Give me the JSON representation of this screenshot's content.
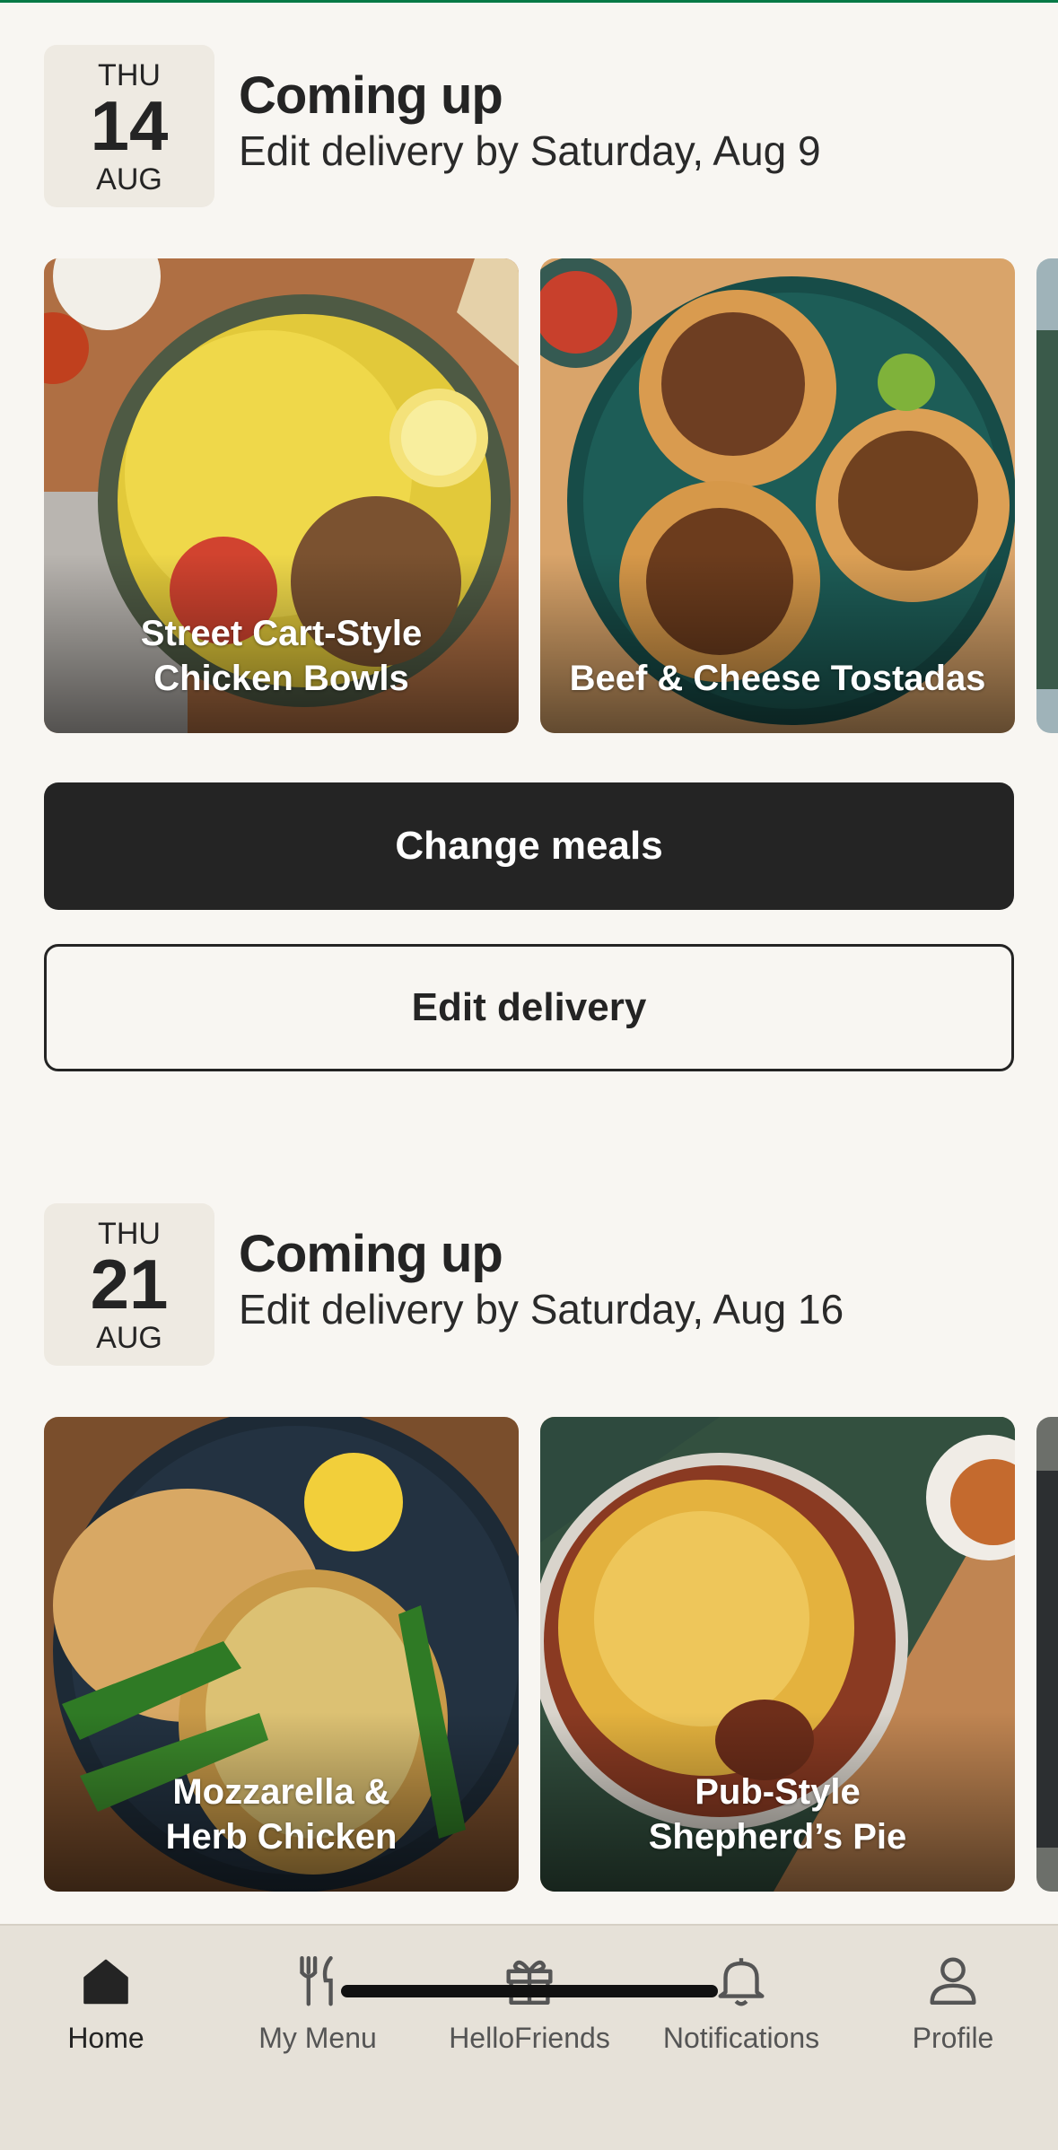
{
  "deliveries": [
    {
      "date": {
        "dow": "THU",
        "day": "14",
        "month": "AUG"
      },
      "title": "Coming up",
      "subtitle": "Edit delivery by Saturday, Aug 9",
      "meals": [
        {
          "name": "Street Cart-Style\nChicken Bowls"
        },
        {
          "name": "Beef & Cheese Tostadas"
        }
      ],
      "primary_button": "Change meals",
      "secondary_button": "Edit delivery"
    },
    {
      "date": {
        "dow": "THU",
        "day": "21",
        "month": "AUG"
      },
      "title": "Coming up",
      "subtitle": "Edit delivery by Saturday, Aug 16",
      "meals": [
        {
          "name": "Mozzarella &\nHerb Chicken"
        },
        {
          "name": "Pub-Style\nShepherd’s Pie"
        }
      ]
    }
  ],
  "tabbar": [
    {
      "label": "Home",
      "icon": "home-icon",
      "active": true
    },
    {
      "label": "My Menu",
      "icon": "fork-knife-icon",
      "active": false
    },
    {
      "label": "HelloFriends",
      "icon": "gift-icon",
      "active": false
    },
    {
      "label": "Notifications",
      "icon": "bell-icon",
      "active": false
    },
    {
      "label": "Profile",
      "icon": "person-icon",
      "active": false
    }
  ],
  "colors": {
    "background": "#f8f6f2",
    "primary_button": "#242424",
    "tabbar": "#e6e1d8",
    "date_box": "#eeeae2",
    "brand_green": "#067a46"
  }
}
